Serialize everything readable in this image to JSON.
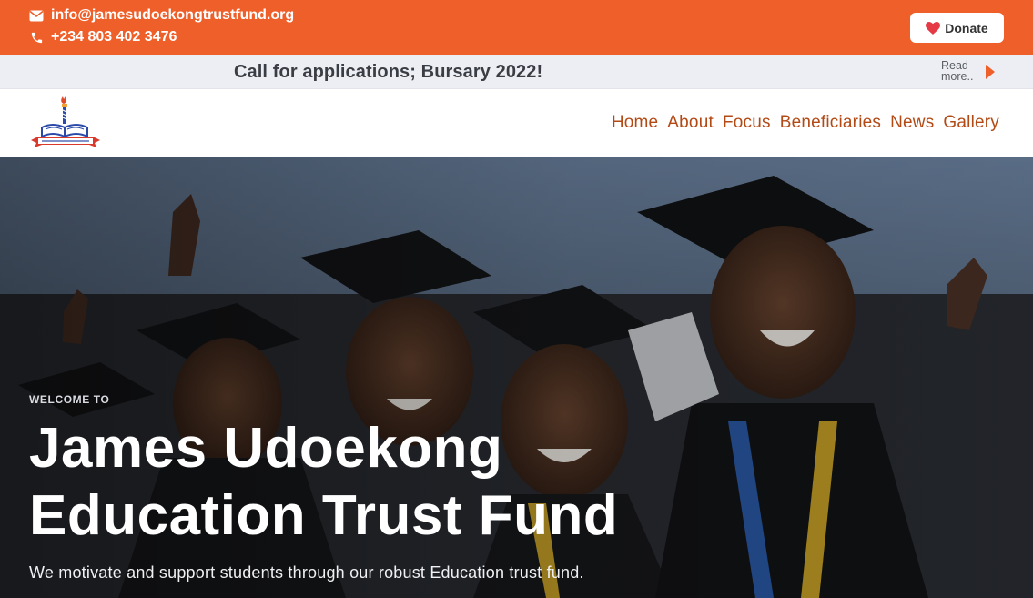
{
  "topbar": {
    "email": "info@jamesudoekongtrustfund.org",
    "phone": "+234 803 402 3476",
    "donate_label": "Donate"
  },
  "announcement": {
    "text": "Call for applications; Bursary 2022!",
    "read_more_line1": "Read",
    "read_more_line2": "more.."
  },
  "nav": {
    "items": [
      "Home",
      "About",
      "Focus",
      "Beneficiaries",
      "News",
      "Gallery"
    ]
  },
  "hero": {
    "eyebrow": "WELCOME TO",
    "title_line1": "James Udoekong",
    "title_line2": "Education Trust Fund",
    "subtitle": "We motivate and support students through our robust Education trust fund."
  },
  "icons": {
    "email": "envelope-icon",
    "phone": "phone-icon",
    "donate": "heart-icon",
    "read_more": "caret-right-icon"
  },
  "colors": {
    "brand_orange": "#ef5f2a",
    "nav_text": "#b34a16",
    "announce_bg": "#eceef3",
    "heart": "#e53946"
  }
}
